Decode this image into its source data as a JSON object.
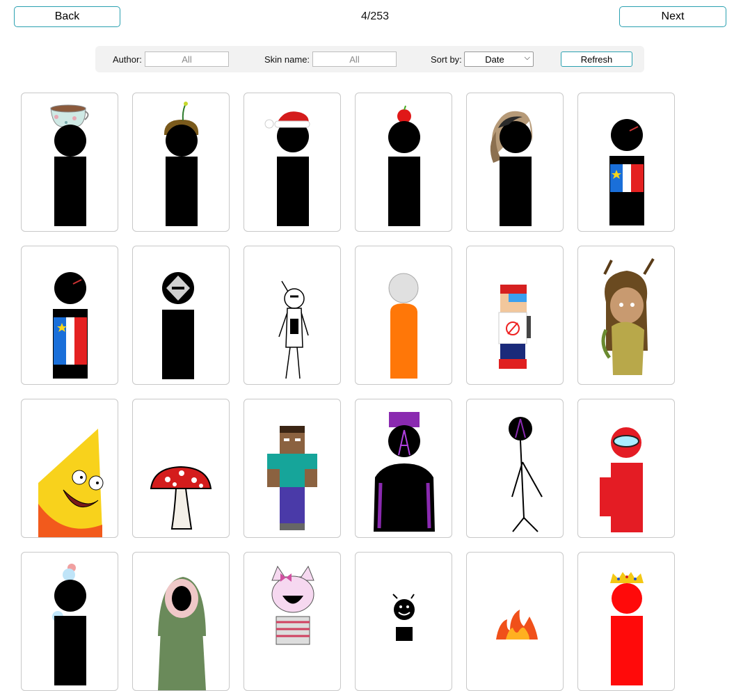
{
  "nav": {
    "back_label": "Back",
    "next_label": "Next",
    "page_counter": "4/253"
  },
  "filters": {
    "author_label": "Author:",
    "author_placeholder": "All",
    "skin_label": "Skin name:",
    "skin_placeholder": "All",
    "sort_label": "Sort by:",
    "sort_value": "Date",
    "refresh_label": "Refresh"
  },
  "colors": {
    "accent": "#2aa0b0",
    "filter_bar_bg": "#f2f2f2",
    "card_border": "#c8c8c8"
  },
  "skins": [
    "teacup-hat-skin",
    "sprout-hair-skin",
    "santa-hat-skin",
    "apple-head-skin",
    "ponytail-hair-skin",
    "acadian-flag-jacket-skin",
    "acadian-flag-jacket-skin-2",
    "diamond-mask-skin",
    "outline-doodle-skin",
    "orange-figure-skin",
    "pixel-rapper-skin",
    "forest-girl-skin",
    "cartoon-kid-skin",
    "red-mushroom-skin",
    "blocky-character-skin",
    "purple-crown-cloak-skin",
    "stick-figure-skin",
    "red-visor-skin",
    "ice-cream-hat-skin",
    "green-hood-skin",
    "pink-cat-girl-skin",
    "smiley-face-skin",
    "fire-skin",
    "red-crown-skin"
  ]
}
